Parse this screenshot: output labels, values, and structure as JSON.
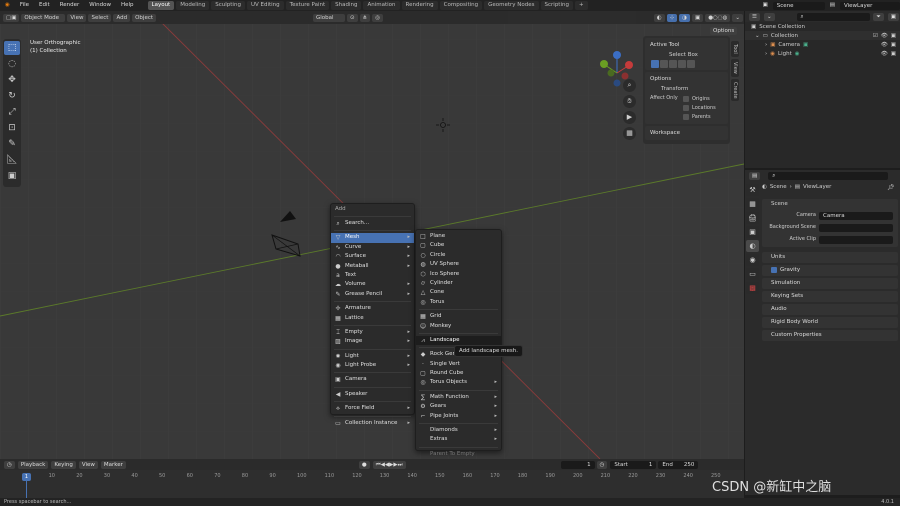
{
  "topbar": {
    "menus": [
      "File",
      "Edit",
      "Render",
      "Window",
      "Help"
    ],
    "workspaces": [
      "Layout",
      "Modeling",
      "Sculpting",
      "UV Editing",
      "Texture Paint",
      "Shading",
      "Animation",
      "Rendering",
      "Compositing",
      "Geometry Nodes",
      "Scripting"
    ],
    "active_workspace": "Layout",
    "scene": "Scene",
    "view_layer": "ViewLayer"
  },
  "viewport": {
    "mode": "Object Mode",
    "menus": [
      "View",
      "Select",
      "Add",
      "Object"
    ],
    "orientation": "Global",
    "options_label": "Options",
    "view_name": "User Orthographic",
    "collection": "(1) Collection",
    "gizmo_axes": {
      "x": "X",
      "y": "Y",
      "z": "Z"
    }
  },
  "npanel": {
    "active_tool_header": "Active Tool",
    "select_box": "Select Box",
    "options_header": "Options",
    "transform": "Transform",
    "affect_only": "Affect Only",
    "affect_items": [
      "Origins",
      "Locations",
      "Parents"
    ],
    "workspace": "Workspace",
    "tabs": [
      "Tool",
      "View",
      "Create"
    ]
  },
  "add_menu": {
    "title": "Add",
    "search": "Search...",
    "items": [
      {
        "label": "Mesh",
        "icon": "mesh-icon",
        "arrow": true,
        "highlight": true
      },
      {
        "label": "Curve",
        "icon": "curve-icon",
        "arrow": true
      },
      {
        "label": "Surface",
        "icon": "surface-icon",
        "arrow": true
      },
      {
        "label": "Metaball",
        "icon": "metaball-icon",
        "arrow": true
      },
      {
        "label": "Text",
        "icon": "text-icon",
        "arrow": false
      },
      {
        "label": "Volume",
        "icon": "volume-icon",
        "arrow": true
      },
      {
        "label": "Grease Pencil",
        "icon": "grease-pencil-icon",
        "arrow": true
      },
      {
        "sep": true
      },
      {
        "label": "Armature",
        "icon": "armature-icon",
        "arrow": false
      },
      {
        "label": "Lattice",
        "icon": "lattice-icon",
        "arrow": false
      },
      {
        "sep": true
      },
      {
        "label": "Empty",
        "icon": "empty-icon",
        "arrow": true
      },
      {
        "label": "Image",
        "icon": "image-icon",
        "arrow": true
      },
      {
        "sep": true
      },
      {
        "label": "Light",
        "icon": "light-icon",
        "arrow": true
      },
      {
        "label": "Light Probe",
        "icon": "light-probe-icon",
        "arrow": true
      },
      {
        "sep": true
      },
      {
        "label": "Camera",
        "icon": "camera-icon",
        "arrow": false
      },
      {
        "sep": true
      },
      {
        "label": "Speaker",
        "icon": "speaker-icon",
        "arrow": false
      },
      {
        "sep": true
      },
      {
        "label": "Force Field",
        "icon": "force-field-icon",
        "arrow": true
      },
      {
        "sep": true
      },
      {
        "label": "Collection Instance",
        "icon": "collection-icon",
        "arrow": true
      }
    ]
  },
  "mesh_menu": {
    "items": [
      {
        "label": "Plane",
        "icon": "plane-icon"
      },
      {
        "label": "Cube",
        "icon": "cube-icon"
      },
      {
        "label": "Circle",
        "icon": "circle-icon"
      },
      {
        "label": "UV Sphere",
        "icon": "uv-sphere-icon"
      },
      {
        "label": "Ico Sphere",
        "icon": "ico-sphere-icon"
      },
      {
        "label": "Cylinder",
        "icon": "cylinder-icon"
      },
      {
        "label": "Cone",
        "icon": "cone-icon"
      },
      {
        "label": "Torus",
        "icon": "torus-icon"
      },
      {
        "sep": true
      },
      {
        "label": "Grid",
        "icon": "grid-icon"
      },
      {
        "label": "Monkey",
        "icon": "monkey-icon"
      },
      {
        "sep": true
      },
      {
        "label": "Landscape",
        "icon": "landscape-icon",
        "selected": true
      },
      {
        "sep": true
      },
      {
        "label": "Rock Generator",
        "icon": "rock-icon"
      },
      {
        "label": "Single Vert",
        "icon": "vert-icon"
      },
      {
        "label": "Round Cube",
        "icon": "round-cube-icon"
      },
      {
        "label": "Torus Objects",
        "icon": "torus-objects-icon",
        "arrow": true
      },
      {
        "sep": true
      },
      {
        "label": "Math Function",
        "icon": "math-icon",
        "arrow": true
      },
      {
        "label": "Gears",
        "icon": "gears-icon",
        "arrow": true
      },
      {
        "label": "Pipe Joints",
        "icon": "pipe-icon",
        "arrow": true
      },
      {
        "sep": true
      },
      {
        "label": "Diamonds",
        "icon": "",
        "arrow": true
      },
      {
        "label": "Extras",
        "icon": "",
        "arrow": true
      },
      {
        "sep": true
      },
      {
        "label": "Parent To Empty",
        "icon": "",
        "dim": true
      }
    ],
    "tooltip": "Add landscape mesh."
  },
  "outliner": {
    "scene_collection": "Scene Collection",
    "items": [
      {
        "label": "Collection",
        "indent": 0
      },
      {
        "label": "Camera",
        "indent": 1
      },
      {
        "label": "Light",
        "indent": 1
      }
    ]
  },
  "properties": {
    "breadcrumb_scene": "Scene",
    "breadcrumb_layer": "ViewLayer",
    "scene_header": "Scene",
    "camera_label": "Camera",
    "camera_value": "Camera",
    "background_scene": "Background Scene",
    "active_clip": "Active Clip",
    "sections": [
      "Units",
      "Gravity",
      "Simulation",
      "Keying Sets",
      "Audio",
      "Rigid Body World",
      "Custom Properties"
    ]
  },
  "timeline": {
    "playback": "Playback",
    "keying": "Keying",
    "view": "View",
    "marker": "Marker",
    "current_frame": "1",
    "start_label": "Start",
    "start": "1",
    "end_label": "End",
    "end": "250",
    "ticks": [
      "10",
      "20",
      "30",
      "40",
      "50",
      "60",
      "70",
      "80",
      "90",
      "100",
      "110",
      "120",
      "130",
      "140",
      "150",
      "160",
      "170",
      "180",
      "190",
      "200",
      "210",
      "220",
      "230",
      "240",
      "250"
    ],
    "playhead": "1"
  },
  "statusbar": {
    "hint": "Press spacebar to search...",
    "version": "4.0.1",
    "watermark": "CSDN @新缸中之脑"
  },
  "colors": {
    "accent": "#4772b3",
    "x_axis": "#a24141",
    "y_axis": "#6a8e23"
  }
}
